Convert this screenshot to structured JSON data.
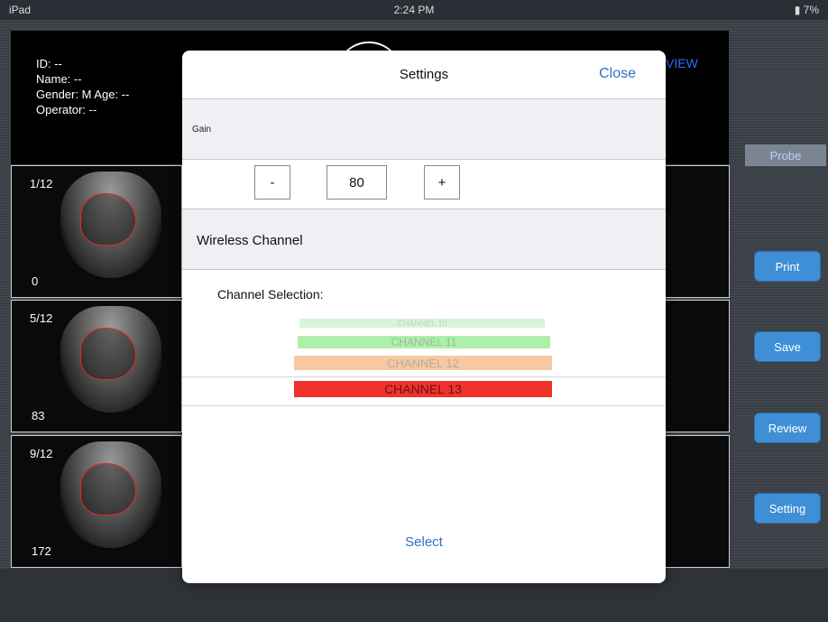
{
  "status_bar": {
    "device": "iPad",
    "time": "2:24 PM",
    "battery": "7%"
  },
  "patient": {
    "id": "ID: --",
    "name": "Name: --",
    "gender_age": "Gender: M    Age: --",
    "operator": "Operator: --"
  },
  "review_partial": "VIEW",
  "thumbnails": [
    {
      "frame": "1/12",
      "value": "0"
    },
    {
      "frame": "5/12",
      "value": "83"
    },
    {
      "frame": "9/12",
      "value": "172"
    }
  ],
  "side_buttons": {
    "probe": "Probe",
    "print": "Print",
    "save": "Save",
    "review": "Review",
    "setting": "Setting"
  },
  "settings": {
    "title": "Settings",
    "close": "Close",
    "gain_label": "Gain",
    "gain_minus": "-",
    "gain_value": "80",
    "gain_plus": "+",
    "wireless_title": "Wireless Channel",
    "channel_selection_label": "Channel Selection:",
    "channels": [
      "CHANNEL 10",
      "CHANNEL 11",
      "CHANNEL 12",
      "CHANNEL 13"
    ],
    "selected_channel": "CHANNEL 13",
    "select": "Select"
  },
  "colors": {
    "accent_blue": "#2a73c4",
    "button_blue": "#3e8fd6",
    "selected_channel": "#f0322c"
  }
}
